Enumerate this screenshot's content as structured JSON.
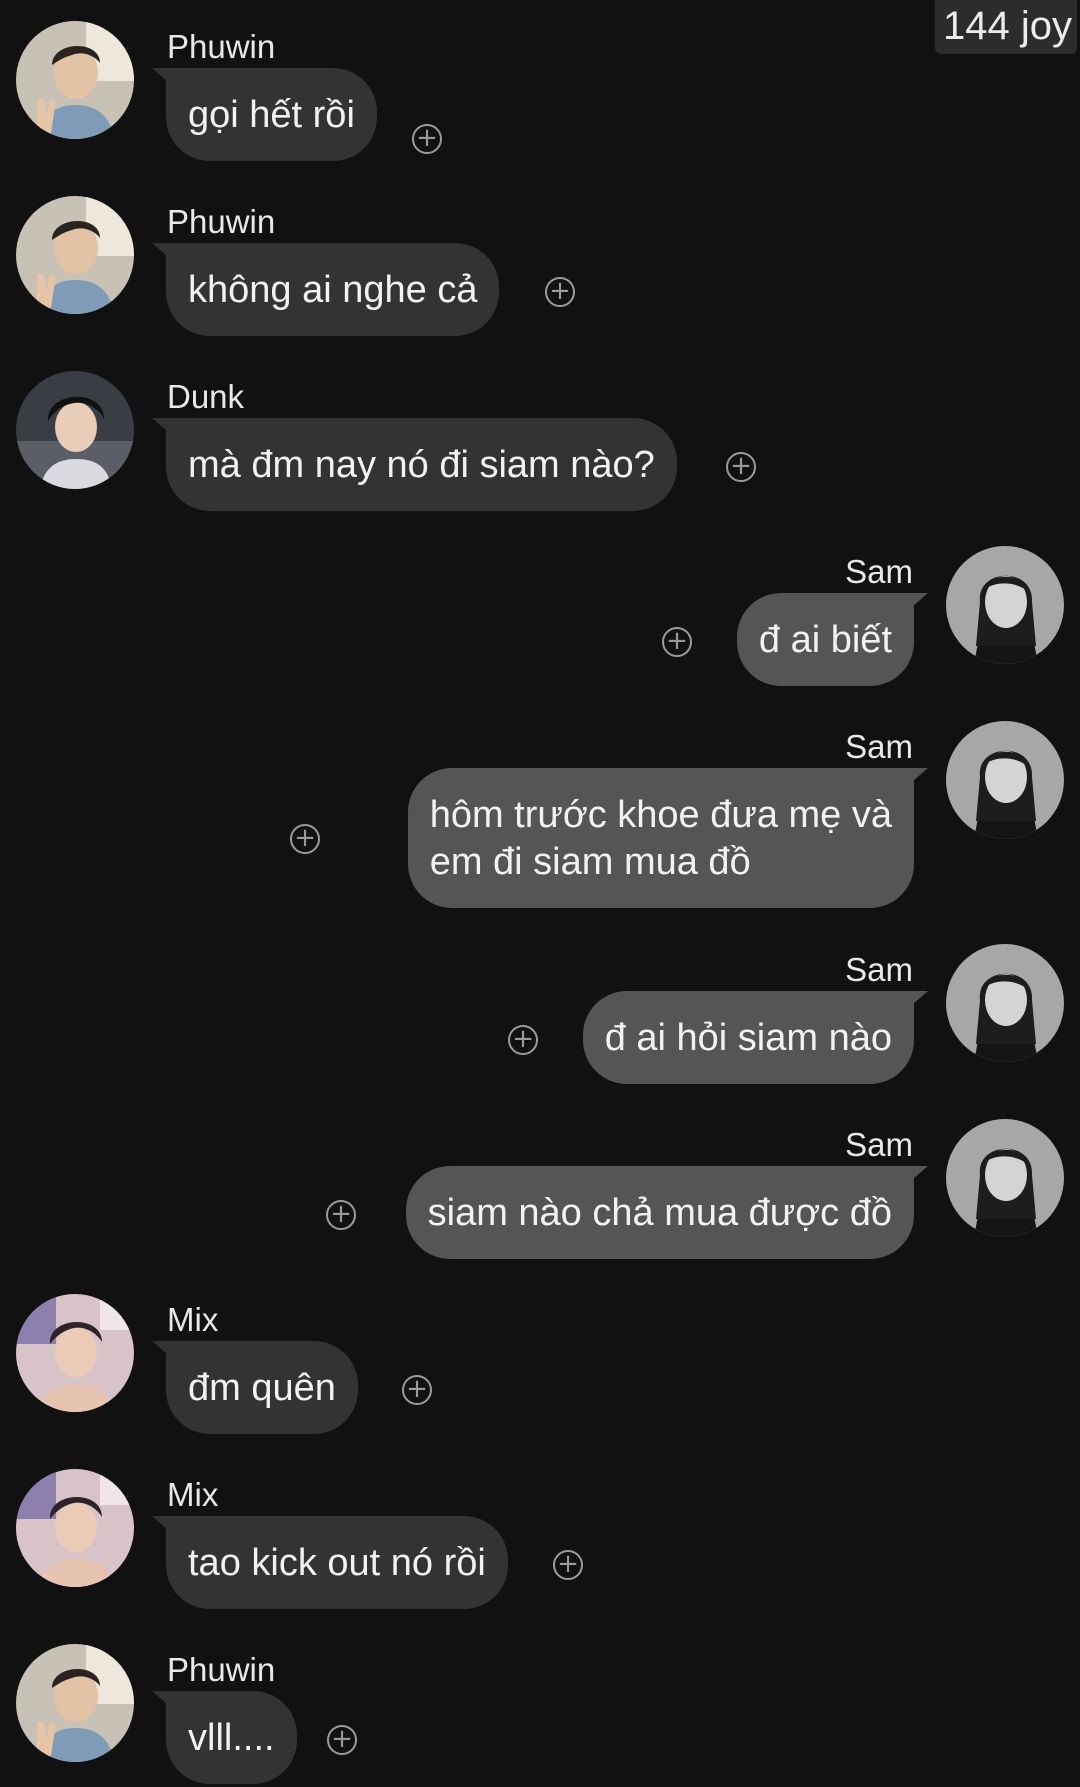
{
  "watermark": "144 joy",
  "react_icon_glyph": "+",
  "colors": {
    "background": "#111111",
    "bubble_incoming": "#333333",
    "bubble_outgoing": "#555555",
    "text": "#f2f2f2",
    "icon": "#9a9a9a"
  },
  "messages": [
    {
      "sender": "Phuwin",
      "side": "left",
      "avatar": "phuwin-avatar",
      "text": "gọi hết rồi"
    },
    {
      "sender": "Phuwin",
      "side": "left",
      "avatar": "phuwin-avatar",
      "text": "không ai nghe cả"
    },
    {
      "sender": "Dunk",
      "side": "left",
      "avatar": "dunk-avatar",
      "text": "mà đm nay nó đi siam nào?"
    },
    {
      "sender": "Sam",
      "side": "right",
      "avatar": "sam-avatar",
      "text": "đ ai biết"
    },
    {
      "sender": "Sam",
      "side": "right",
      "avatar": "sam-avatar",
      "text": "hôm trước khoe đưa mẹ và\nem đi siam mua đồ"
    },
    {
      "sender": "Sam",
      "side": "right",
      "avatar": "sam-avatar",
      "text": "đ ai hỏi siam nào"
    },
    {
      "sender": "Sam",
      "side": "right",
      "avatar": "sam-avatar",
      "text": "siam nào chả mua được đồ"
    },
    {
      "sender": "Mix",
      "side": "left",
      "avatar": "mix-avatar",
      "text": "đm quên"
    },
    {
      "sender": "Mix",
      "side": "left",
      "avatar": "mix-avatar",
      "text": "tao kick out nó rồi"
    },
    {
      "sender": "Phuwin",
      "side": "left",
      "avatar": "phuwin-avatar",
      "text": "vlll...."
    }
  ]
}
